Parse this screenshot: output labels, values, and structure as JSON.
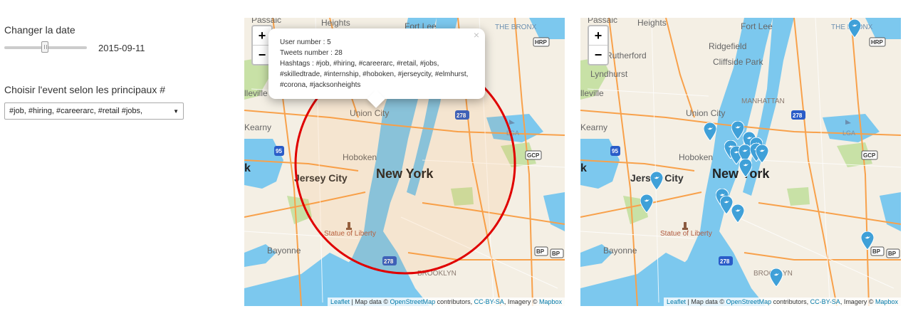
{
  "controls": {
    "date_label": "Changer la date",
    "date_value": "2015-09-11",
    "event_label": "Choisir l'event selon les principaux #",
    "event_selected": "#job, #hiring, #careerarc, #retail #jobs,"
  },
  "map_labels": {
    "passaic": "Passaic",
    "heights": "Heights",
    "fort_lee": "Fort Lee",
    "bronx": "THE BRONX",
    "rutherford": "Rutherford",
    "ridgefield": "Ridgefield",
    "cliffside": "Cliffside Park",
    "lyndhurst": "Lyndhurst",
    "belleville": "lleville",
    "kearny": "Kearny",
    "union_city": "Union City",
    "manhattan": "MANHATTAN",
    "hoboken": "Hoboken",
    "jersey_city": "Jersey City",
    "new_york": "New York",
    "liberty": "Statue of Liberty",
    "bayonne": "Bayonne",
    "brooklyn": "BROOKLYN",
    "lga": "LGA",
    "k": "k",
    "shield_95": "95",
    "shield_278a": "278",
    "shield_278b": "278",
    "hrp": "HRP",
    "gcp": "GCP",
    "bp": "BP",
    "bp2": "BP",
    "bp3": "BP"
  },
  "zoom": {
    "in": "+",
    "out": "−"
  },
  "attribution": {
    "leaflet": "Leaflet",
    "sep": " | Map data © ",
    "osm": "OpenStreetMap",
    "contrib": " contributors, ",
    "license": "CC-BY-SA",
    "imagery": ", Imagery © ",
    "mapbox": "Mapbox"
  },
  "popup": {
    "close": "×",
    "user_number": "User number : 5",
    "tweets_number": "Tweets number : 28",
    "hashtags": "Hashtags : #job, #hiring, #careerarc, #retail, #jobs, #skilledtrade, #internship, #hoboken, #jerseycity, #elmhurst, #corona, #jacksonheights"
  },
  "colors": {
    "water": "#7cc8ee",
    "land": "#f4efe4",
    "road": "#f8a14b",
    "park": "#c8e1a6",
    "circle": "#e00000",
    "marker": "#3fa0d8"
  },
  "icons": {
    "marker": "twitter-bird-icon",
    "liberty": "monument-icon",
    "airport": "airplane-icon"
  }
}
